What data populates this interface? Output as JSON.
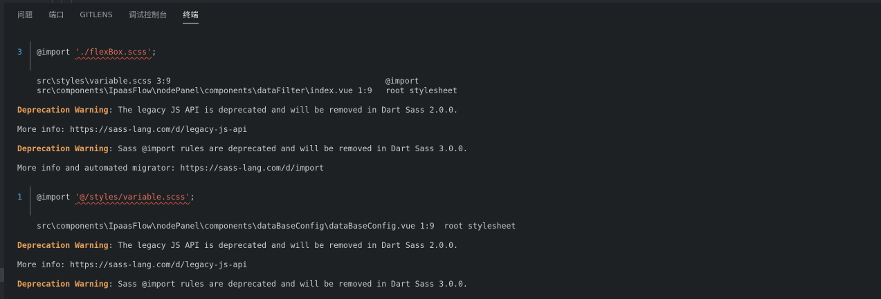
{
  "tabs": [
    "问题",
    "端口",
    "GITLENS",
    "调试控制台",
    "终端"
  ],
  "active_tab": "终端",
  "colors": {
    "background": "#1e2124",
    "line_number": "#4a9fe0",
    "string": "#e0705c",
    "warning": "#e9a05a",
    "text": "#c8c8c8"
  },
  "output": {
    "block1": {
      "line_number": "3",
      "import_kw": "@import ",
      "import_path": "'./flexBox.scss'",
      "import_end": ";",
      "trace1_file": "src\\styles\\variable.scss 3:9",
      "trace1_ctx": "@import",
      "trace2_file": "src\\components\\IpaasFlow\\nodePanel\\components\\dataFilter\\index.vue 1:9",
      "trace2_ctx": "root stylesheet"
    },
    "warn1_label": "Deprecation Warning",
    "warn1_text": ": The legacy JS API is deprecated and will be removed in Dart Sass 2.0.0.",
    "info1": "More info: https://sass-lang.com/d/legacy-js-api",
    "warn2_label": "Deprecation Warning",
    "warn2_text": ": Sass @import rules are deprecated and will be removed in Dart Sass 3.0.0.",
    "info2": "More info and automated migrator: https://sass-lang.com/d/import",
    "block2": {
      "line_number": "1",
      "import_kw": "@import ",
      "import_path": "'@/styles/variable.scss'",
      "import_end": ";",
      "trace1": "src\\components\\IpaasFlow\\nodePanel\\components\\dataBaseConfig\\dataBaseConfig.vue 1:9  root stylesheet"
    },
    "warn3_label": "Deprecation Warning",
    "warn3_text": ": The legacy JS API is deprecated and will be removed in Dart Sass 2.0.0.",
    "info3": "More info: https://sass-lang.com/d/legacy-js-api",
    "warn4_label": "Deprecation Warning",
    "warn4_text": ": Sass @import rules are deprecated and will be removed in Dart Sass 3.0.0."
  }
}
